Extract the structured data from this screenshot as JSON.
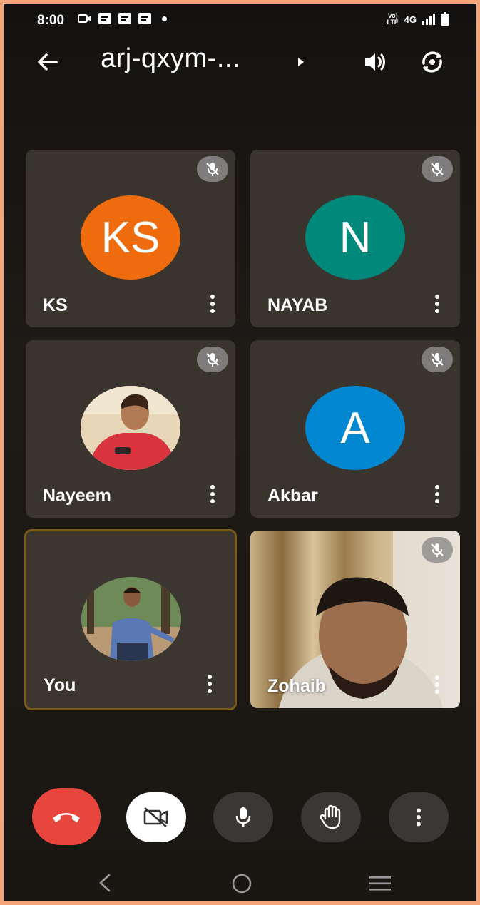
{
  "status_bar": {
    "time": "8:00",
    "volte": "Vo) LTE",
    "network": "4G"
  },
  "header": {
    "title": "arj-qxym-...",
    "icons": [
      "back-arrow-icon",
      "caret-right-icon",
      "speaker-icon",
      "switch-camera-icon"
    ]
  },
  "participants": [
    {
      "name": "KS",
      "initials": "KS",
      "avatar_color": "#ee6c0d",
      "muted": true
    },
    {
      "name": "NAYAB",
      "initials": "N",
      "avatar_color": "#00897b",
      "muted": true
    },
    {
      "name": "Nayeem",
      "initials": "",
      "avatar_color": "#c9a07a",
      "muted": true
    },
    {
      "name": "Akbar",
      "initials": "A",
      "avatar_color": "#0288d1",
      "muted": true
    },
    {
      "name": "You",
      "initials": "",
      "avatar_color": "#5d7a4a",
      "muted": false
    },
    {
      "name": "Zohaib",
      "initials": "",
      "avatar_color": "#8a7a6a",
      "muted": true
    }
  ],
  "controls": {
    "end_call_color": "#e8453c",
    "icons": [
      "end-call-icon",
      "camera-off-icon",
      "mic-icon",
      "raise-hand-icon",
      "more-options-icon"
    ]
  },
  "colors": {
    "background": "#1a1713",
    "tile": "#3a342f",
    "active_border": "#7a5a18",
    "frame": "#f4a57a"
  }
}
